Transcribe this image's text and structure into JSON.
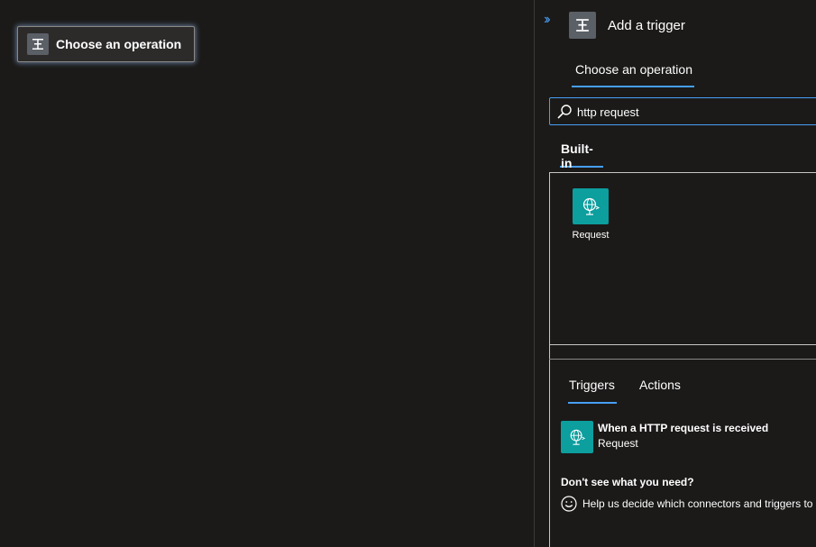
{
  "canvas": {
    "operation_card": {
      "label": "Choose an operation",
      "icon": "trigger-icon"
    }
  },
  "panel": {
    "expand_icon": "chevron-double-right-icon",
    "title": "Add a trigger",
    "title_icon": "trigger-icon",
    "tab": "Choose an operation",
    "search": {
      "value": "http request",
      "icon": "search-icon"
    },
    "builtin_tab": "Built-in",
    "connectors": [
      {
        "label": "Request",
        "icon": "globe-request-icon"
      }
    ],
    "tabs": [
      {
        "label": "Triggers",
        "selected": true
      },
      {
        "label": "Actions",
        "selected": false
      }
    ],
    "results": [
      {
        "name": "When a HTTP request is received",
        "connector": "Request",
        "icon": "globe-request-icon"
      }
    ],
    "help": {
      "title": "Don't see what you need?",
      "text": "Help us decide which connectors and triggers to a",
      "icon": "smiley-icon"
    }
  },
  "colors": {
    "background": "#1b1a19",
    "accent": "#479ef5",
    "connector_tile": "#0d9e9e",
    "trigger_icon_bg": "#5b5f66"
  }
}
